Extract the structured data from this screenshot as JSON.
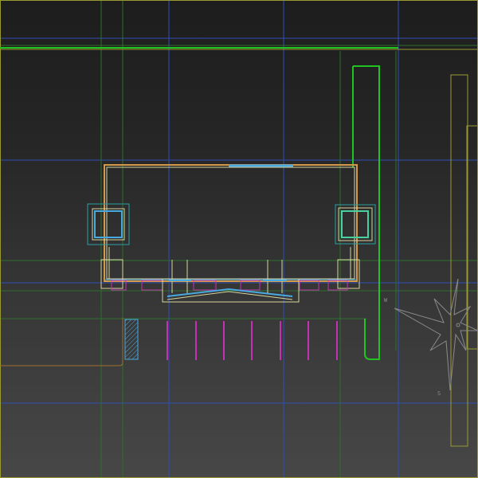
{
  "viewport": {
    "name": "top-view-viewport",
    "background_top": "#1d1d1d",
    "background_bottom": "#474747"
  },
  "colors": {
    "blue_grid": "#2f4fb3",
    "green_grid": "#2e6f2e",
    "bright_green": "#21c321",
    "olive": "#9a9a35",
    "orange": "#d39a4a",
    "magenta": "#c432b4",
    "cyan": "#48a8e0",
    "pale_yellow": "#d8d49c",
    "compass_grey": "#8a8a8a"
  },
  "compass": {
    "labels": [
      "W",
      "S"
    ]
  }
}
